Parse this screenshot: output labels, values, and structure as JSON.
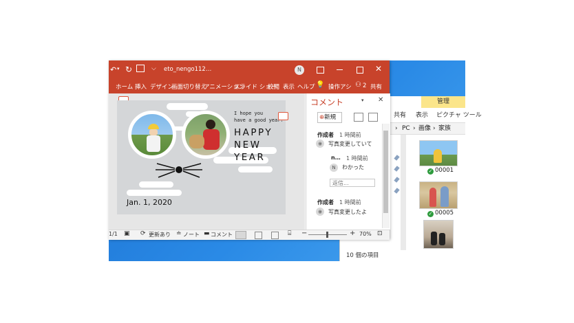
{
  "powerpoint": {
    "title": "eto_nengo112…",
    "avatar": "N",
    "tabs": [
      "ホーム",
      "挿入",
      "デザイン",
      "画面切り替え",
      "アニメーション",
      "スライド ショー",
      "校閲",
      "表示",
      "ヘルプ",
      "操作アシ",
      "共有"
    ],
    "share_count": "2",
    "slide": {
      "greeting_line1": "I hope you",
      "greeting_line2": "have a good year!",
      "headline": [
        "HAPPY",
        "NEW",
        "YEAR"
      ],
      "date": "Jan. 1, 2020"
    },
    "comments": {
      "title": "コメント",
      "new_label": "新規",
      "threads": [
        {
          "author": "作成者",
          "time": "1 時間前",
          "text": "写真変更していて",
          "reply": {
            "author": "n…",
            "time": "1 時間前",
            "avatar": "N",
            "text": "わかった"
          },
          "reply_placeholder": "返信..."
        },
        {
          "author": "作成者",
          "time": "1 時間前",
          "text": "写真変更したよ"
        }
      ]
    },
    "status": {
      "page": "1/1",
      "updates": "更新あり",
      "notes": "ノート",
      "comments": "コメント",
      "zoom": "70%"
    }
  },
  "explorer": {
    "manage_tab": "管理",
    "tabs": [
      "共有",
      "表示",
      "ピクチャ ツール"
    ],
    "breadcrumb": [
      "PC",
      "画像",
      "家族"
    ],
    "files": [
      "00001",
      "00005"
    ],
    "status": "10 個の項目"
  },
  "colors": {
    "accent": "#c8432b",
    "desktop": "#2a8ae6",
    "manage": "#fbe58a"
  }
}
